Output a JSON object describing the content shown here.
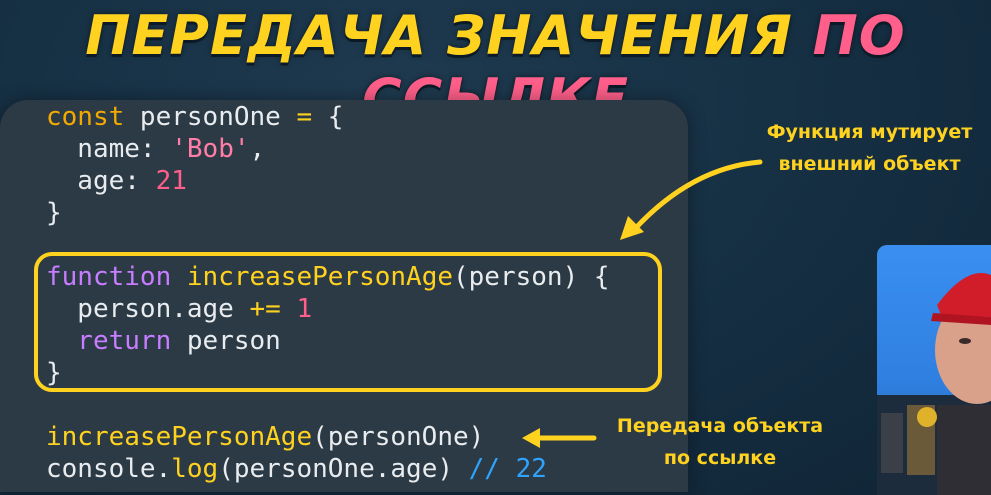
{
  "title": {
    "part1": "ПЕРЕДАЧА ЗНАЧЕНИЯ",
    "part2": "ПО ССЫЛКЕ"
  },
  "code": {
    "line1": {
      "kw": "const",
      "name": " personOne ",
      "op": "=",
      "rest": " {"
    },
    "line2": {
      "key": "  name: ",
      "str": "'Bob'",
      "rest": ","
    },
    "line3": {
      "key": "  age: ",
      "num": "21"
    },
    "line4": "}",
    "line5": {
      "kw": "function",
      "fname": " increasePersonAge",
      "rest": "(person) {"
    },
    "line6": {
      "lhs": "  person.age ",
      "op": "+=",
      "num": " 1"
    },
    "line7": {
      "kw": "  return",
      "rest": " person"
    },
    "line8": "}",
    "line9": {
      "fname": "increasePersonAge",
      "rest": "(personOne)"
    },
    "line10": {
      "obj": "console.",
      "fname": "log",
      "rest": "(personOne.age) ",
      "comment": "// 22"
    }
  },
  "notes": {
    "mutates": {
      "line1": "Функция мутирует",
      "line2": "внешний объект"
    },
    "pass_ref": {
      "line1": "Передача объекта",
      "line2": "по ссылке"
    }
  },
  "colors": {
    "accent_yellow": "#ffd21f",
    "accent_pink": "#ff5f8a",
    "panel": "#2c3a45",
    "comment_blue": "#2fa4ff"
  }
}
